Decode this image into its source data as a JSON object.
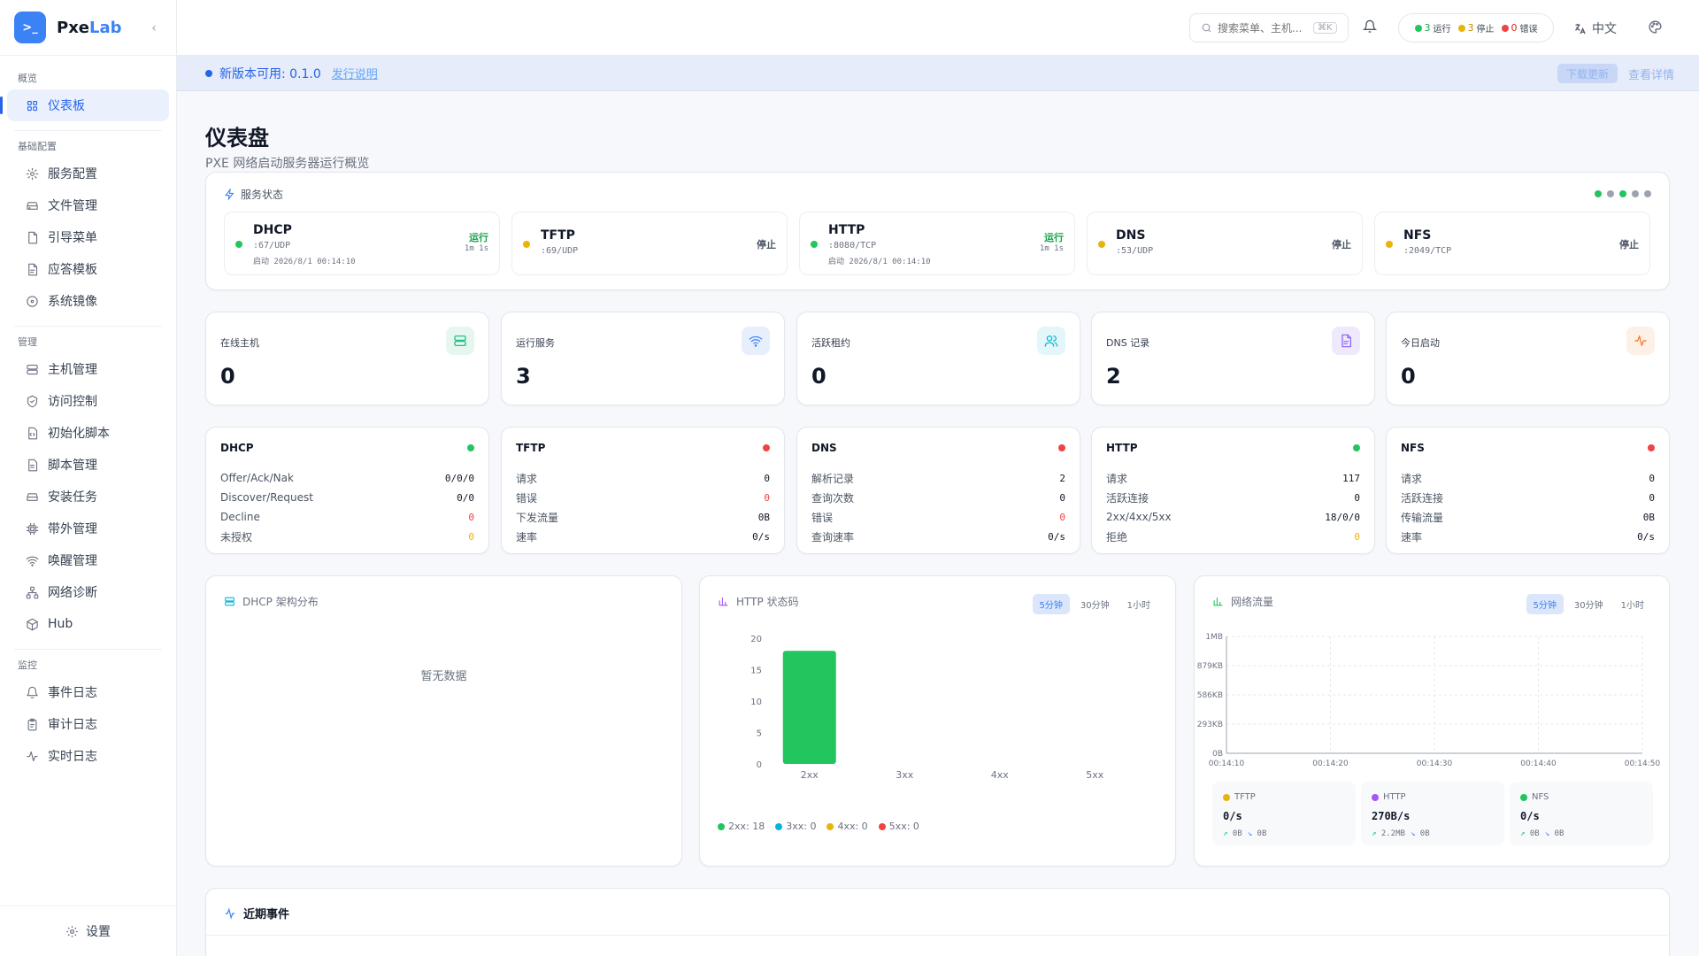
{
  "brand": {
    "logo": ">_",
    "name_a": "Pxe",
    "name_b": "Lab"
  },
  "sidebar": {
    "sections": [
      {
        "title": "概览",
        "items": [
          {
            "label": "仪表板",
            "icon": "grid-icon",
            "active": true
          }
        ]
      },
      {
        "title": "基础配置",
        "items": [
          {
            "label": "服务配置",
            "icon": "gear-icon"
          },
          {
            "label": "文件管理",
            "icon": "hard-drive-icon"
          },
          {
            "label": "引导菜单",
            "icon": "file-icon"
          },
          {
            "label": "应答模板",
            "icon": "file-text-icon"
          },
          {
            "label": "系统镜像",
            "icon": "disc-icon"
          }
        ]
      },
      {
        "title": "管理",
        "items": [
          {
            "label": "主机管理",
            "icon": "server-icon"
          },
          {
            "label": "访问控制",
            "icon": "shield-icon"
          },
          {
            "label": "初始化脚本",
            "icon": "file-code-icon"
          },
          {
            "label": "脚本管理",
            "icon": "script-icon"
          },
          {
            "label": "安装任务",
            "icon": "drive-icon"
          },
          {
            "label": "带外管理",
            "icon": "cpu-icon"
          },
          {
            "label": "唤醒管理",
            "icon": "wifi-icon"
          },
          {
            "label": "网络诊断",
            "icon": "network-icon"
          },
          {
            "label": "Hub",
            "icon": "package-icon"
          }
        ]
      },
      {
        "title": "监控",
        "items": [
          {
            "label": "事件日志",
            "icon": "bell-icon"
          },
          {
            "label": "审计日志",
            "icon": "clipboard-icon"
          },
          {
            "label": "实时日志",
            "icon": "activity-icon"
          }
        ]
      }
    ],
    "footer_label": "设置"
  },
  "topbar": {
    "search_placeholder": "搜索菜单、主机...",
    "search_kbd": "⌘K",
    "status": {
      "running": "3",
      "running_label": "运行",
      "stopped": "3",
      "stopped_label": "停止",
      "error": "0",
      "error_label": "错误"
    },
    "lang": "中文"
  },
  "banner": {
    "text": "新版本可用: 0.1.0",
    "release_notes": "发行说明",
    "download": "下载更新",
    "view": "查看详情"
  },
  "page": {
    "title": "仪表盘",
    "subtitle": "PXE 网络启动服务器运行概览"
  },
  "service_status": {
    "title": "服务状态",
    "services": [
      {
        "name": "DHCP",
        "port": ":67/UDP",
        "started": "启动 2026/8/1 00:14:10",
        "state": "运行",
        "uptime": "1m 1s",
        "running": true
      },
      {
        "name": "TFTP",
        "port": ":69/UDP",
        "started": "",
        "state": "停止",
        "uptime": "",
        "running": false
      },
      {
        "name": "HTTP",
        "port": ":8080/TCP",
        "started": "启动 2026/8/1 00:14:10",
        "state": "运行",
        "uptime": "1m 1s",
        "running": true
      },
      {
        "name": "DNS",
        "port": ":53/UDP",
        "started": "",
        "state": "停止",
        "uptime": "",
        "running": false
      },
      {
        "name": "NFS",
        "port": ":2049/TCP",
        "started": "",
        "state": "停止",
        "uptime": "",
        "running": false
      }
    ]
  },
  "stats": [
    {
      "label": "在线主机",
      "value": "0",
      "icon": "server-icon",
      "color": "#10b981",
      "bg": "#e6f7ef"
    },
    {
      "label": "运行服务",
      "value": "3",
      "icon": "wifi-icon",
      "color": "#3b82f6",
      "bg": "#e8effc"
    },
    {
      "label": "活跃租约",
      "value": "0",
      "icon": "users-icon",
      "color": "#06b6d4",
      "bg": "#e3f6f9"
    },
    {
      "label": "DNS 记录",
      "value": "2",
      "icon": "file-text-icon",
      "color": "#8b5cf6",
      "bg": "#efe9fc"
    },
    {
      "label": "今日启动",
      "value": "0",
      "icon": "activity-icon",
      "color": "#f97316",
      "bg": "#fdf0e6"
    }
  ],
  "metrics": [
    {
      "title": "DHCP",
      "dot": "#22c55e",
      "rows": [
        {
          "k": "Offer/Ack/Nak",
          "v": "0/0/0",
          "c": "#111827"
        },
        {
          "k": "Discover/Request",
          "v": "0/0",
          "c": "#111827"
        },
        {
          "k": "Decline",
          "v": "0",
          "c": "#ef4444"
        },
        {
          "k": "未授权",
          "v": "0",
          "c": "#eab308"
        }
      ]
    },
    {
      "title": "TFTP",
      "dot": "#ef4444",
      "rows": [
        {
          "k": "请求",
          "v": "0",
          "c": "#111827"
        },
        {
          "k": "错误",
          "v": "0",
          "c": "#ef4444"
        },
        {
          "k": "下发流量",
          "v": "0B",
          "c": "#111827"
        },
        {
          "k": "速率",
          "v": "0/s",
          "c": "#111827"
        }
      ]
    },
    {
      "title": "DNS",
      "dot": "#ef4444",
      "rows": [
        {
          "k": "解析记录",
          "v": "2",
          "c": "#111827"
        },
        {
          "k": "查询次数",
          "v": "0",
          "c": "#111827"
        },
        {
          "k": "错误",
          "v": "0",
          "c": "#ef4444"
        },
        {
          "k": "查询速率",
          "v": "0/s",
          "c": "#111827"
        }
      ]
    },
    {
      "title": "HTTP",
      "dot": "#22c55e",
      "rows": [
        {
          "k": "请求",
          "v": "117",
          "c": "#111827"
        },
        {
          "k": "活跃连接",
          "v": "0",
          "c": "#111827"
        },
        {
          "k": "2xx/4xx/5xx",
          "v": "18/0/0",
          "c": "#111827"
        },
        {
          "k": "拒绝",
          "v": "0",
          "c": "#eab308"
        }
      ]
    },
    {
      "title": "NFS",
      "dot": "#ef4444",
      "rows": [
        {
          "k": "请求",
          "v": "0",
          "c": "#111827"
        },
        {
          "k": "活跃连接",
          "v": "0",
          "c": "#111827"
        },
        {
          "k": "传输流量",
          "v": "0B",
          "c": "#111827"
        },
        {
          "k": "速率",
          "v": "0/s",
          "c": "#111827"
        }
      ]
    }
  ],
  "dhcp_arch": {
    "title": "DHCP 架构分布",
    "empty": "暂无数据"
  },
  "tabs": [
    "5分钟",
    "30分钟",
    "1小时"
  ],
  "http_chart": {
    "title": "HTTP 状态码"
  },
  "net_chart": {
    "title": "网络流量"
  },
  "chart_data": [
    {
      "type": "bar",
      "title": "HTTP 状态码",
      "categories": [
        "2xx",
        "3xx",
        "4xx",
        "5xx"
      ],
      "values": [
        18,
        0,
        0,
        0
      ],
      "yticks": [
        "20",
        "15",
        "10",
        "5",
        "0"
      ],
      "ylim": [
        0,
        20
      ],
      "legend": [
        {
          "label": "2xx: 18",
          "color": "#22c55e"
        },
        {
          "label": "3xx: 0",
          "color": "#06b6d4"
        },
        {
          "label": "4xx: 0",
          "color": "#eab308"
        },
        {
          "label": "5xx: 0",
          "color": "#ef4444"
        }
      ]
    },
    {
      "type": "line",
      "title": "网络流量",
      "x": [
        "00:14:10",
        "00:14:20",
        "00:14:30",
        "00:14:40",
        "00:14:50"
      ],
      "yticks": [
        "1MB",
        "879KB",
        "586KB",
        "293KB",
        "0B"
      ],
      "grid": true,
      "series": []
    }
  ],
  "traffic": [
    {
      "name": "TFTP",
      "color": "#eab308",
      "rate": "0/s",
      "up": "0B",
      "down": "0B"
    },
    {
      "name": "HTTP",
      "color": "#a855f7",
      "rate": "270B/s",
      "up": "2.2MB",
      "down": "0B"
    },
    {
      "name": "NFS",
      "color": "#22c55e",
      "rate": "0/s",
      "up": "0B",
      "down": "0B"
    }
  ],
  "events": {
    "title": "近期事件"
  }
}
